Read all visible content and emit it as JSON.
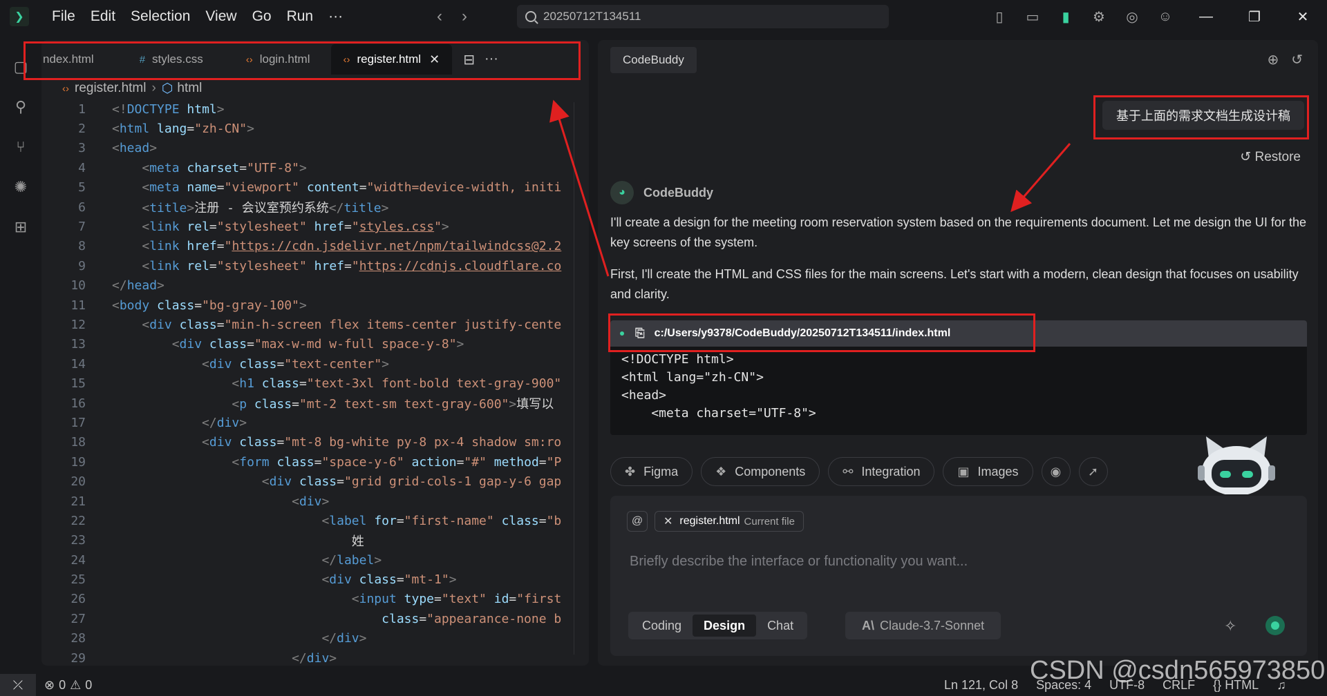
{
  "menu": [
    "File",
    "Edit",
    "Selection",
    "View",
    "Go",
    "Run",
    "···"
  ],
  "search": {
    "value": "20250712T134511"
  },
  "tabs": [
    {
      "label": "ndex.html",
      "icon": "html-icon",
      "glyph": "‹›"
    },
    {
      "label": "styles.css",
      "icon": "css-icon",
      "glyph": "#"
    },
    {
      "label": "login.html",
      "icon": "html-icon",
      "glyph": "‹›"
    },
    {
      "label": "register.html",
      "icon": "html-icon",
      "glyph": "‹›",
      "active": true
    }
  ],
  "breadcrumb": {
    "file": "register.html",
    "node": "html"
  },
  "line_numbers": [
    "1",
    "2",
    "3",
    "4",
    "5",
    "6",
    "7",
    "8",
    "9",
    "10",
    "11",
    "12",
    "13",
    "14",
    "15",
    "16",
    "17",
    "18",
    "19",
    "20",
    "21",
    "22",
    "23",
    "24",
    "25",
    "26",
    "27",
    "28",
    "29"
  ],
  "chat": {
    "tag": "CodeBuddy",
    "user_message": "基于上面的需求文档生成设计稿",
    "restore": "Restore",
    "bot_name": "CodeBuddy",
    "para1": "I'll create a design for the meeting room reservation system based on the requirements document. Let me design the UI for the key screens of the system.",
    "para2": "First, I'll create the HTML and CSS files for the main screens. Let's start with a modern, clean design that focuses on usability and clarity.",
    "code_file": "c:/Users/y9378/CodeBuddy/20250712T134511/index.html",
    "code_lines": "<!DOCTYPE html>\n<html lang=\"zh-CN\">\n<head>\n    <meta charset=\"UTF-8\">",
    "chips": [
      "Figma",
      "Components",
      "Integration",
      "Images"
    ],
    "context_file": "register.html",
    "context_sub": "Current file",
    "placeholder": "Briefly describe the interface or functionality you want...",
    "modes": [
      "Coding",
      "Design",
      "Chat"
    ],
    "model": "Claude-3.7-Sonnet"
  },
  "status": {
    "errors": "0",
    "warnings": "0",
    "position": "Ln 121, Col 8",
    "spaces": "Spaces: 4",
    "encoding": "UTF-8",
    "eol": "CRLF",
    "language": "HTML"
  },
  "watermark": "CSDN @csdn565973850",
  "colors": {
    "accent": "#3ad29f",
    "annotation": "#e02020",
    "editor_bg": "#1e1f22"
  }
}
